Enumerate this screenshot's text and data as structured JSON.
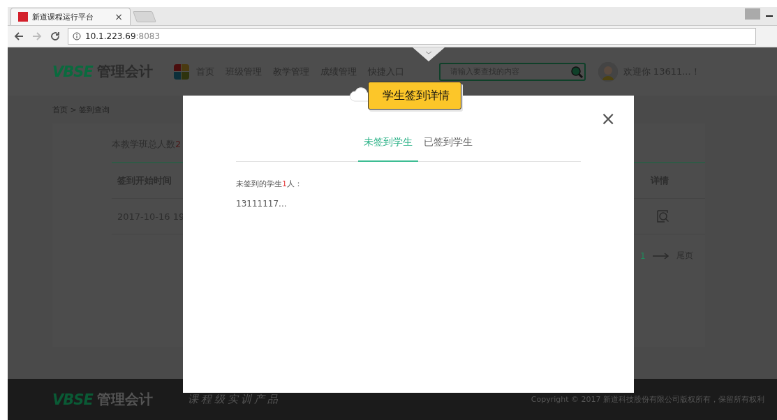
{
  "browser": {
    "tab_title": "新道课程运行平台",
    "tab_close": "×",
    "url_host": "10.1.223.69",
    "url_port": ":8083"
  },
  "header": {
    "logo_mark": "VBSE",
    "logo_text": "管理会计",
    "nav": [
      {
        "label": "首页"
      },
      {
        "label": "班级管理"
      },
      {
        "label": "教学管理"
      },
      {
        "label": "成绩管理"
      },
      {
        "label": "快捷入口"
      }
    ],
    "search_placeholder": "请输入要查找的内容",
    "welcome": "欢迎你 13611...！"
  },
  "breadcrumb": "首页 > 签到查询",
  "card": {
    "total_label": "本教学班总人数",
    "total_count": "2",
    "columns": [
      "签到开始时间",
      "详情"
    ],
    "rows": [
      [
        "2017-10-16 19"
      ]
    ],
    "pagination": {
      "page": "1",
      "last": "尾页"
    }
  },
  "footer": {
    "logo_mark": "VBSE",
    "logo_text": "管理会计",
    "slogan": "课程级实训产品",
    "copyright": "Copyright © 2017 新道科技股份有限公司版权所有，保留所有权利"
  },
  "modal": {
    "title": "学生签到详情",
    "close": "×",
    "tabs": [
      {
        "label": "未签到学生",
        "selected": true
      },
      {
        "label": "已签到学生",
        "selected": false
      }
    ],
    "summary": {
      "prefix": "未签到的学生",
      "count": "1",
      "suffix": "人："
    },
    "students": [
      "13111117..."
    ]
  }
}
